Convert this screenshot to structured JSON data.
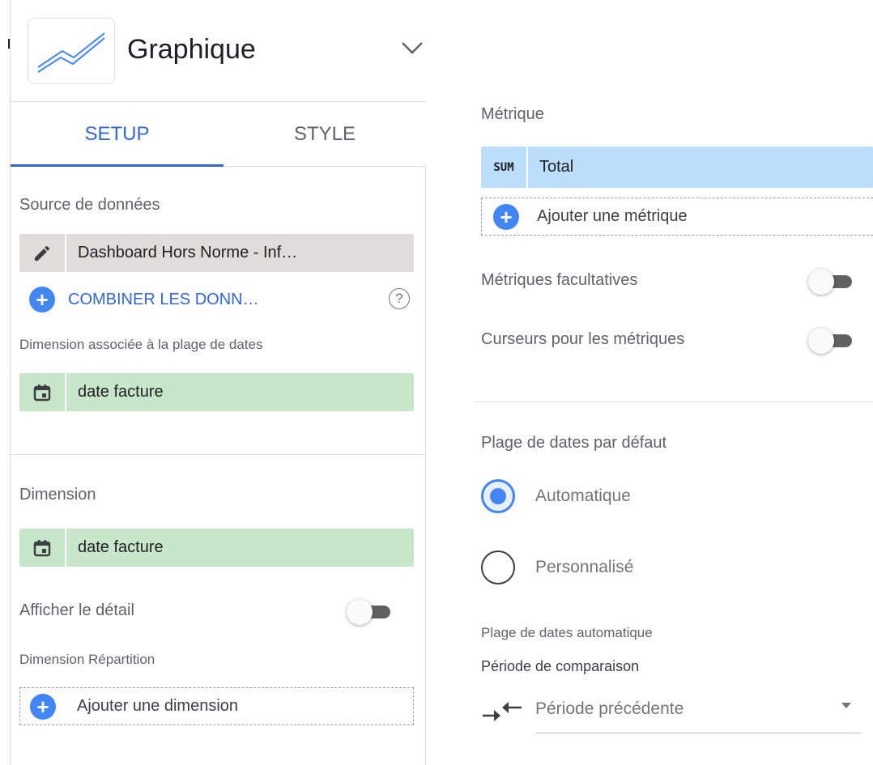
{
  "header": {
    "title": "Graphique"
  },
  "tabs": [
    {
      "label": "SETUP",
      "active": true
    },
    {
      "label": "STYLE",
      "active": false
    }
  ],
  "data_source": {
    "label": "Source de données",
    "value": "Dashboard Hors Norme - Inf…",
    "blend_label": "COMBINER LES DONN…"
  },
  "date_range_dimension": {
    "label": "Dimension associée à la plage de dates",
    "value": "date facture"
  },
  "dimension": {
    "label": "Dimension",
    "value": "date facture"
  },
  "drill_down": {
    "label": "Afficher le détail",
    "enabled": false
  },
  "breakdown": {
    "label": "Dimension Répartition",
    "add_label": "Ajouter une dimension"
  },
  "metric": {
    "label": "Métrique",
    "items": [
      {
        "aggregation": "SUM",
        "name": "Total"
      }
    ],
    "add_label": "Ajouter une métrique"
  },
  "optional_metrics": {
    "label": "Métriques facultatives",
    "enabled": false
  },
  "metric_sliders": {
    "label": "Curseurs pour les métriques",
    "enabled": false
  },
  "default_date_range": {
    "label": "Plage de dates par défaut",
    "options": [
      {
        "label": "Automatique",
        "selected": true
      },
      {
        "label": "Personnalisé",
        "selected": false
      }
    ],
    "auto_label": "Plage de dates automatique",
    "comparison_label": "Période de comparaison",
    "comparison_value": "Période précédente"
  },
  "colors": {
    "accent": "#4285f4",
    "tab_active": "#3367d6",
    "chip_datasource": "#e0dcd9",
    "chip_dimension": "#c8e6c9",
    "chip_metric": "#bbdefb"
  }
}
